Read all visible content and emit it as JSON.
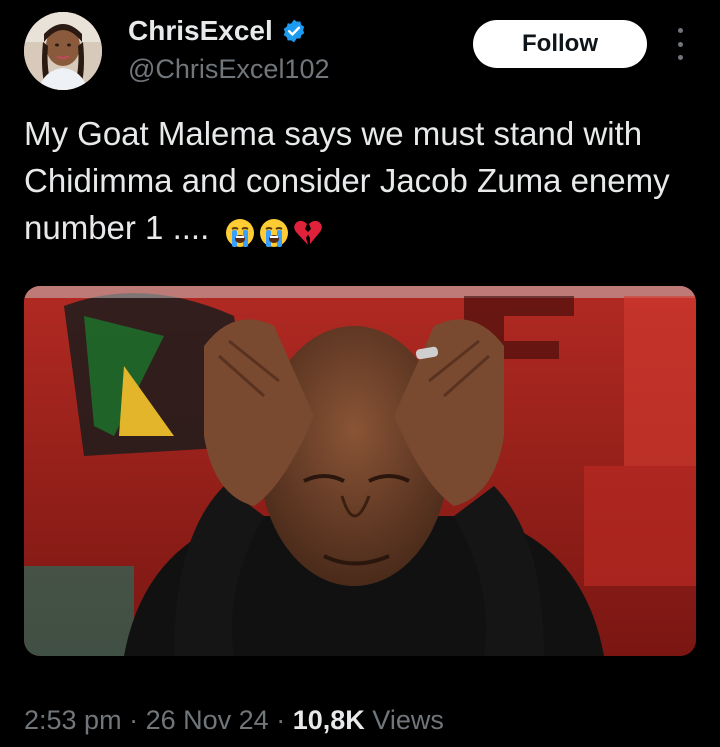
{
  "author": {
    "display_name": "ChrisExcel",
    "handle": "@ChrisExcel102",
    "verified": true
  },
  "follow_button": {
    "label": "Follow"
  },
  "tweet": {
    "text": "My Goat Malema says we must stand with Chidimma and consider Jacob Zuma enemy number 1 ....",
    "emojis": [
      "loudly-crying-face-icon",
      "loudly-crying-face-icon",
      "broken-heart-icon"
    ]
  },
  "meta": {
    "time": "2:53 pm",
    "separator": "·",
    "date": "26 Nov 24",
    "views_count": "10,8K",
    "views_label": "Views"
  },
  "colors": {
    "background": "#000000",
    "text_primary": "#e7e9ea",
    "text_secondary": "#71767b",
    "verified_blue": "#1d9bf0",
    "follow_bg": "#ffffff"
  }
}
